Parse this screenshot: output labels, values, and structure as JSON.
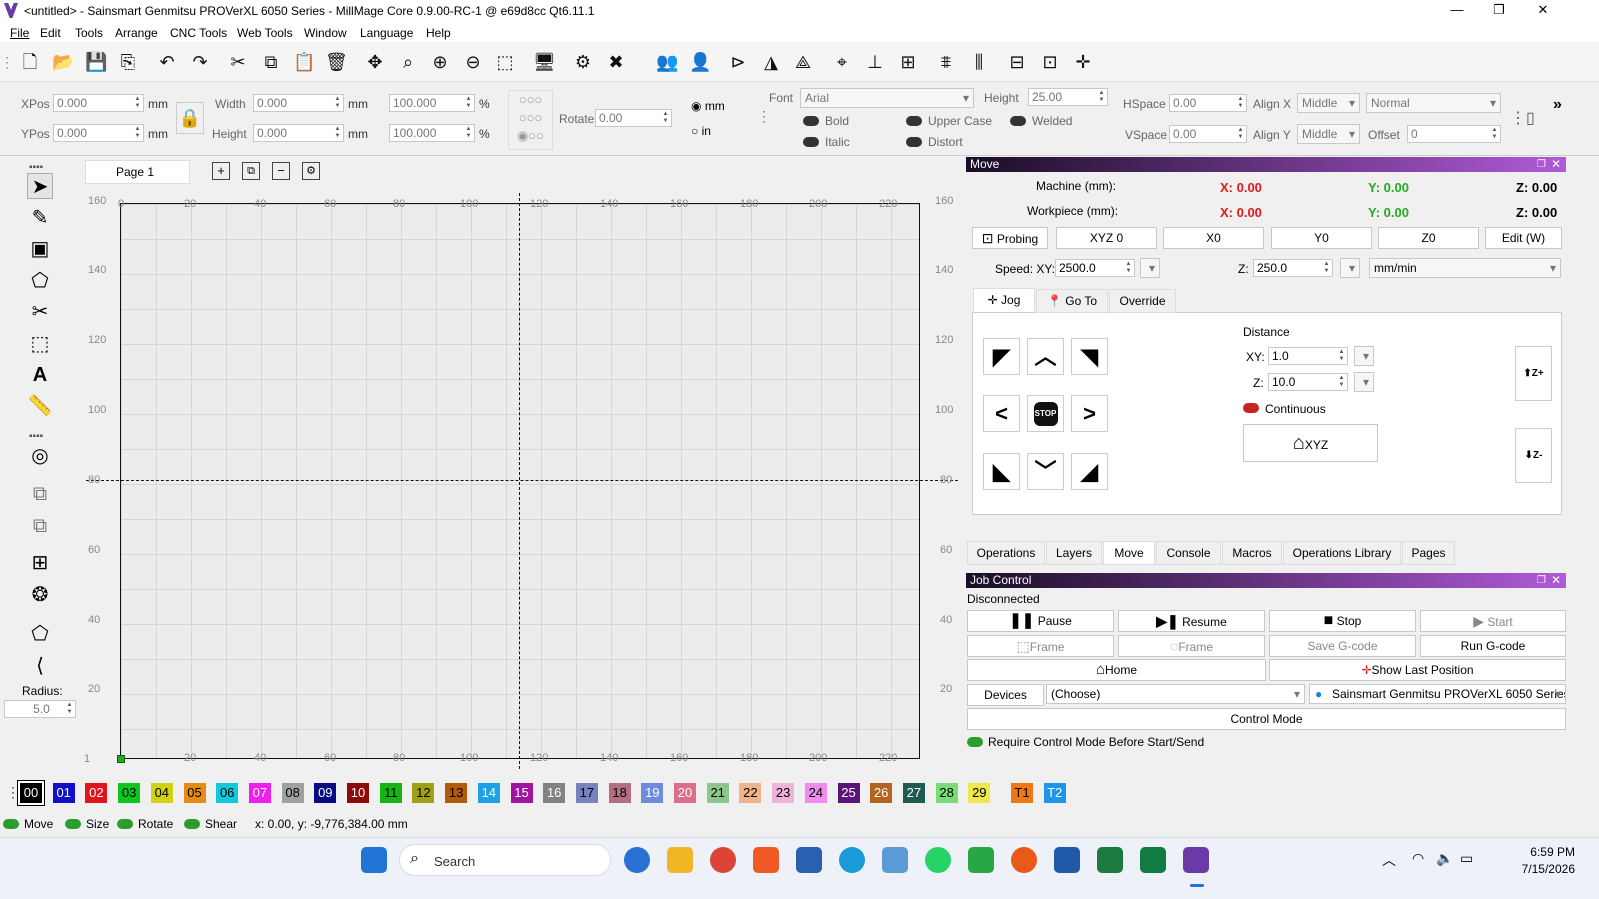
{
  "window": {
    "title": "<untitled> - Sainsmart Genmitsu PROVerXL 6050 Series - MillMage Core 0.9.00-RC-1 @ e69d8cc Qt6.11.1"
  },
  "menu": [
    "File",
    "Edit",
    "Tools",
    "Arrange",
    "CNC Tools",
    "Web Tools",
    "Window",
    "Language",
    "Help"
  ],
  "props": {
    "xpos_label": "XPos",
    "ypos_label": "YPos",
    "xpos": "0.000",
    "ypos": "0.000",
    "unit": "mm",
    "width_label": "Width",
    "height_label": "Height",
    "width": "0.000",
    "height": "0.000",
    "pct1": "100.000",
    "pct2": "100.000",
    "pct": "%",
    "rotate_label": "Rotate",
    "rotate": "0.00",
    "unit_mm": "mm",
    "unit_in": "in",
    "font_label": "Font",
    "font": "Arial",
    "fheight_label": "Height",
    "fheight": "25.00",
    "bold": "Bold",
    "italic": "Italic",
    "upper": "Upper Case",
    "distort": "Distort",
    "welded": "Welded",
    "hspace_label": "HSpace",
    "hspace": "0.00",
    "vspace_label": "VSpace",
    "vspace": "0.00",
    "alignx_label": "Align X",
    "alignx": "Middle",
    "aligny_label": "Align Y",
    "aligny": "Middle",
    "style": "Normal",
    "offset_label": "Offset",
    "offset": "0"
  },
  "left": {
    "radius_label": "Radius:",
    "radius": "5.0"
  },
  "page": {
    "tab": "Page 1"
  },
  "ruler": {
    "x": [
      "0",
      "20",
      "40",
      "60",
      "80",
      "100",
      "120",
      "140",
      "160",
      "180",
      "200",
      "220"
    ],
    "y_left": [
      "160",
      "140",
      "120",
      "100",
      "80",
      "60",
      "40",
      "20",
      "1"
    ],
    "y_right": [
      "160",
      "140",
      "120",
      "100",
      "80",
      "60",
      "40",
      "20"
    ]
  },
  "move": {
    "title": "Move",
    "machine_label": "Machine (mm):",
    "workpiece_label": "Workpiece (mm):",
    "mx": "X: 0.00",
    "my": "Y: 0.00",
    "mz": "Z: 0.00",
    "wx": "X: 0.00",
    "wy": "Y: 0.00",
    "wz": "Z: 0.00",
    "probing": "Probing",
    "xyz0": "XYZ 0",
    "x0": "X0",
    "y0": "Y0",
    "z0": "Z0",
    "edit": "Edit (W)",
    "speed_label": "Speed: XY:",
    "speed_xy": "2500.0",
    "z_label": "Z:",
    "speed_z": "250.0",
    "units": "mm/min",
    "tab_jog": "Jog",
    "tab_goto": "Go To",
    "tab_override": "Override",
    "distance": "Distance",
    "xy_label": "XY:",
    "dist_xy": "1.0",
    "zz_label": "Z:",
    "dist_z": "10.0",
    "continuous": "Continuous",
    "home_xyz": "XYZ",
    "stop": "STOP",
    "zplus": "Z+",
    "zminus": "Z-"
  },
  "dock_tabs": [
    "Operations",
    "Layers",
    "Move",
    "Console",
    "Macros",
    "Operations Library",
    "Pages"
  ],
  "job": {
    "title": "Job Control",
    "status": "Disconnected",
    "pause": "Pause",
    "resume": "Resume",
    "stop": "Stop",
    "start": "Start",
    "frame1": "Frame",
    "frame2": "Frame",
    "save": "Save G-code",
    "run": "Run G-code",
    "home": "Home",
    "show_last": "Show Last Position",
    "devices": "Devices",
    "choose": "(Choose)",
    "device": "Sainsmart Genmitsu PROVerXL 6050 Series",
    "control": "Control Mode",
    "require": "Require Control Mode Before Start/Send"
  },
  "palette": [
    {
      "l": "00",
      "c": "#000000",
      "t": "#ffffff"
    },
    {
      "l": "01",
      "c": "#1010c8",
      "t": "#ffffff"
    },
    {
      "l": "02",
      "c": "#e0141e",
      "t": "#ffffff"
    },
    {
      "l": "03",
      "c": "#0cc81e",
      "t": "#000000"
    },
    {
      "l": "04",
      "c": "#d2d214",
      "t": "#000000"
    },
    {
      "l": "05",
      "c": "#e68c14",
      "t": "#000000"
    },
    {
      "l": "06",
      "c": "#14c8dc",
      "t": "#000000"
    },
    {
      "l": "07",
      "c": "#f01ef0",
      "t": "#ffffff"
    },
    {
      "l": "08",
      "c": "#a0a0a0",
      "t": "#000000"
    },
    {
      "l": "09",
      "c": "#0a0a82",
      "t": "#ffffff"
    },
    {
      "l": "10",
      "c": "#8c0a0a",
      "t": "#ffffff"
    },
    {
      "l": "11",
      "c": "#14b414",
      "t": "#000000"
    },
    {
      "l": "12",
      "c": "#a0a014",
      "t": "#000000"
    },
    {
      "l": "13",
      "c": "#b45a0a",
      "t": "#000000"
    },
    {
      "l": "14",
      "c": "#1ea0e6",
      "t": "#ffffff"
    },
    {
      "l": "15",
      "c": "#a014a0",
      "t": "#ffffff"
    },
    {
      "l": "16",
      "c": "#828282",
      "t": "#ffffff"
    },
    {
      "l": "17",
      "c": "#7882be",
      "t": "#000000"
    },
    {
      "l": "18",
      "c": "#b46e82",
      "t": "#000000"
    },
    {
      "l": "19",
      "c": "#6e8cdc",
      "t": "#ffffff"
    },
    {
      "l": "20",
      "c": "#dc6e8c",
      "t": "#ffffff"
    },
    {
      "l": "21",
      "c": "#8cc88c",
      "t": "#000000"
    },
    {
      "l": "22",
      "c": "#f0b48c",
      "t": "#000000"
    },
    {
      "l": "23",
      "c": "#f0b4dc",
      "t": "#000000"
    },
    {
      "l": "24",
      "c": "#f08cf0",
      "t": "#000000"
    },
    {
      "l": "25",
      "c": "#5a1478",
      "t": "#ffffff"
    },
    {
      "l": "26",
      "c": "#b4641e",
      "t": "#ffffff"
    },
    {
      "l": "27",
      "c": "#1e5a50",
      "t": "#ffffff"
    },
    {
      "l": "28",
      "c": "#78dc78",
      "t": "#000000"
    },
    {
      "l": "29",
      "c": "#f0e650",
      "t": "#000000"
    },
    {
      "l": "T1",
      "c": "#f07814",
      "t": "#000000"
    },
    {
      "l": "T2",
      "c": "#1e96e6",
      "t": "#ffffff"
    }
  ],
  "status": {
    "move": "Move",
    "size": "Size",
    "rotate": "Rotate",
    "shear": "Shear",
    "coords": "x: 0.00, y: -9,776,384.00 mm"
  },
  "taskbar": {
    "search": "Search",
    "time": "6:59 PM",
    "date": "7/15/2026"
  },
  "colors": {
    "accent": "#b05ad8",
    "red": "#e01818",
    "green": "#22aa22"
  }
}
